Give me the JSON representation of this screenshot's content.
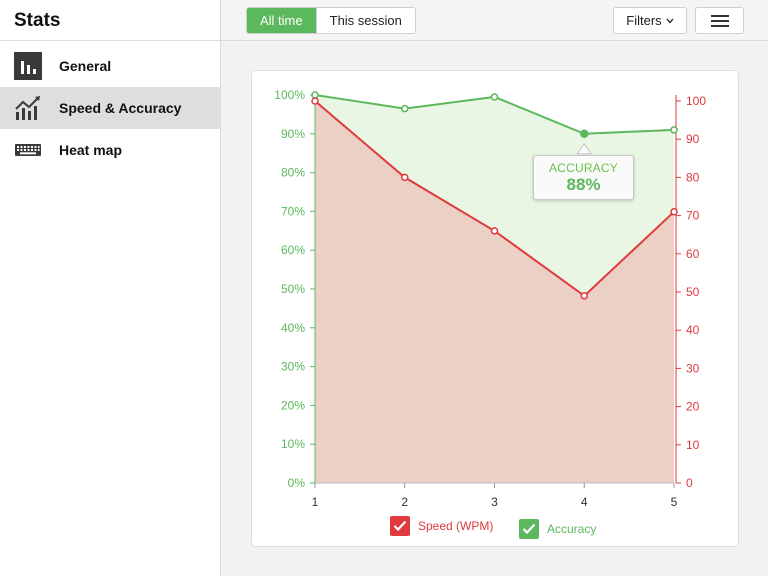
{
  "sidebar": {
    "title": "Stats",
    "items": [
      {
        "label": "General",
        "icon": "bar-chart-icon"
      },
      {
        "label": "Speed & Accuracy",
        "icon": "line-chart-icon",
        "active": true
      },
      {
        "label": "Heat map",
        "icon": "keyboard-icon"
      }
    ]
  },
  "toolbar": {
    "range_all_label": "All time",
    "range_session_label": "This session",
    "filters_label": "Filters",
    "menu_icon": "hamburger-menu-icon"
  },
  "colors": {
    "accuracy": "#5cb85c",
    "speed": "#e0393e",
    "accent": "#5cb85c"
  },
  "tooltip": {
    "label": "ACCURACY",
    "value": "88%"
  },
  "legend": [
    {
      "label": "Speed (WPM)",
      "color": "#e0393e",
      "checked": true
    },
    {
      "label": "Accuracy",
      "color": "#5cb85c",
      "checked": true
    }
  ],
  "chart_data": {
    "type": "area",
    "x": [
      1,
      2,
      3,
      4,
      5
    ],
    "x_ticks": [
      "1",
      "2",
      "3",
      "4",
      "5"
    ],
    "series": [
      {
        "name": "Speed (WPM)",
        "axis": "right",
        "values": [
          100,
          80,
          66,
          49,
          71
        ]
      },
      {
        "name": "Accuracy",
        "axis": "left",
        "values": [
          100,
          96.5,
          99.5,
          90,
          91
        ]
      }
    ],
    "y_left": {
      "ticks": [
        "0%",
        "10%",
        "20%",
        "30%",
        "40%",
        "50%",
        "60%",
        "70%",
        "80%",
        "90%",
        "100%"
      ],
      "ylim": [
        0,
        100
      ]
    },
    "y_right": {
      "ticks": [
        "0",
        "10",
        "20",
        "30",
        "40",
        "50",
        "60",
        "70",
        "80",
        "90",
        "100"
      ],
      "ylim": [
        0,
        100
      ]
    },
    "highlight": {
      "series": "Accuracy",
      "x": 4
    }
  }
}
